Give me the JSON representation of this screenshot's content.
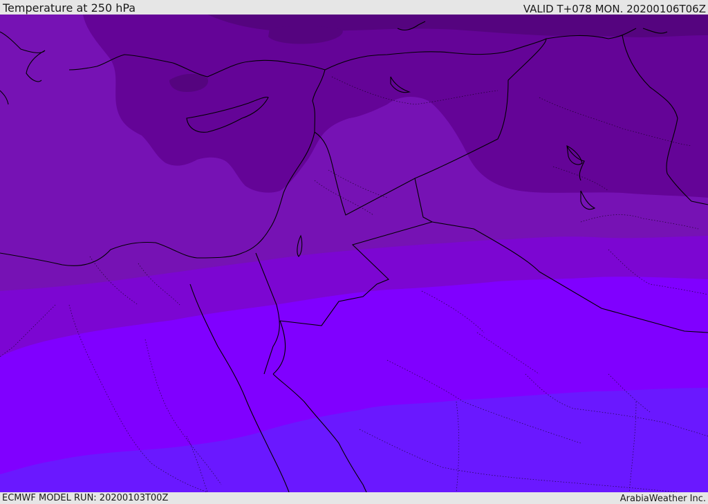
{
  "header": {
    "title": "Temperature at 250 hPa",
    "valid_time": "VALID T+078 MON. 20200106T06Z"
  },
  "footer": {
    "model_run": "ECMWF MODEL RUN: 20200103T00Z",
    "credit": "ArabiaWeather Inc."
  },
  "colors": {
    "band_darkest": "#55047f",
    "band_dark": "#640497",
    "band_mid": "#7612b4",
    "band_purple": "#7c06d2",
    "band_violet": "#8000ff",
    "band_blue_violet": "#6a18ff",
    "border_line": "#000000"
  }
}
